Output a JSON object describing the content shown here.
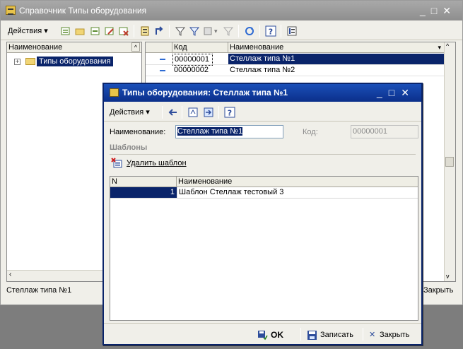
{
  "main_window": {
    "title": "Справочник Типы оборудования",
    "actions_label": "Действия",
    "tree": {
      "header": "Наименование",
      "root_label": "Типы оборудования"
    },
    "list": {
      "columns": [
        "Код",
        "Наименование"
      ],
      "rows": [
        {
          "code": "00000001",
          "name": "Стеллаж типа №1",
          "selected": true
        },
        {
          "code": "00000002",
          "name": "Стеллаж типа №2",
          "selected": false
        }
      ]
    },
    "status_text": "Стеллаж типа №1",
    "close_label": "Закрыть"
  },
  "dialog": {
    "title": "Типы оборудования: Стеллаж типа №1",
    "actions_label": "Действия",
    "name_label": "Наименование:",
    "name_value": "Стеллаж типа №1",
    "code_label": "Код:",
    "code_value": "00000001",
    "group_title": "Шаблоны",
    "delete_template_label": "Удалить шаблон",
    "table": {
      "columns": [
        "N",
        "Наименование"
      ],
      "rows": [
        {
          "n": "1",
          "name": "Шаблон Стеллаж тестовый 3"
        }
      ]
    },
    "footer": {
      "ok_label": "OK",
      "save_label": "Записать",
      "close_label": "Закрыть"
    }
  },
  "colors": {
    "selection": "#0a246a",
    "active_title": "#0b2f8a",
    "inactive_title": "#9a9a9a"
  }
}
